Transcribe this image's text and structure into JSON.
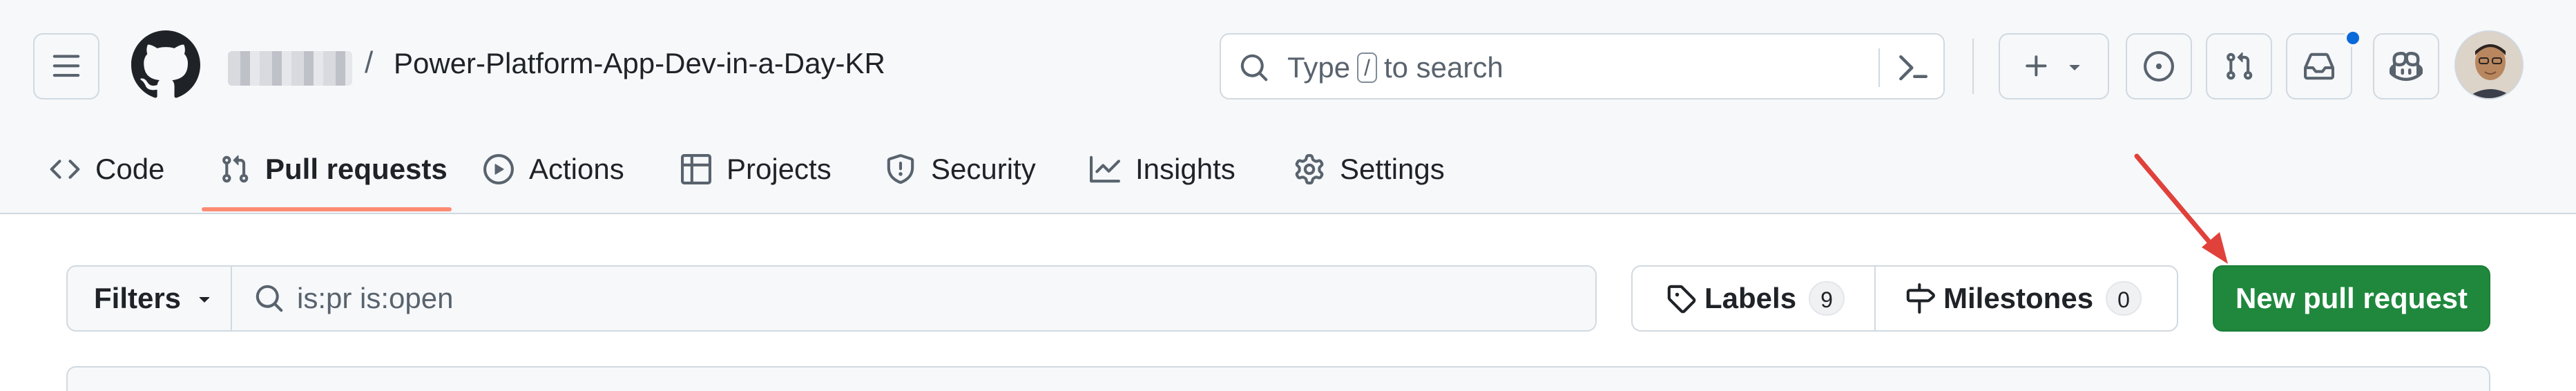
{
  "header": {
    "repo_separator": "/",
    "repo_name": "Power-Platform-App-Dev-in-a-Day-KR"
  },
  "search": {
    "prefix": "Type",
    "shortcut": "/",
    "suffix": "to search"
  },
  "tabs": [
    {
      "label": "Code",
      "icon": "code-icon"
    },
    {
      "label": "Pull requests",
      "icon": "git-pull-request-icon",
      "active": true
    },
    {
      "label": "Actions",
      "icon": "play-icon"
    },
    {
      "label": "Projects",
      "icon": "table-icon"
    },
    {
      "label": "Security",
      "icon": "shield-icon"
    },
    {
      "label": "Insights",
      "icon": "graph-icon"
    },
    {
      "label": "Settings",
      "icon": "gear-icon"
    }
  ],
  "subnav": {
    "filters_label": "Filters",
    "query": "is:pr is:open",
    "labels_label": "Labels",
    "labels_count": "9",
    "milestones_label": "Milestones",
    "milestones_count": "0",
    "new_pr_label": "New pull request"
  },
  "colors": {
    "header_bg": "#f6f8fa",
    "active_tab_underline": "#fd8c73",
    "primary_button": "#1f883d",
    "notification_dot": "#0969da",
    "annotation_arrow": "#e0413a"
  }
}
